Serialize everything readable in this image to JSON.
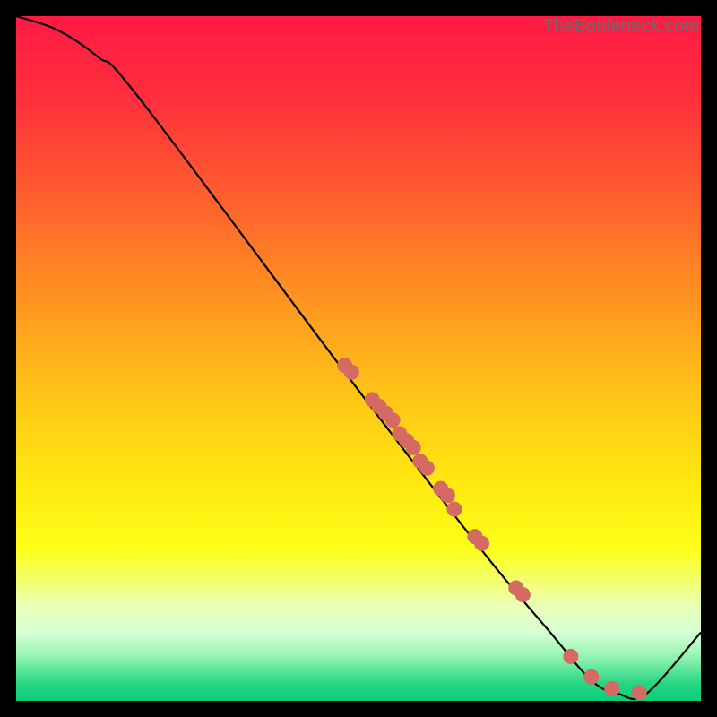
{
  "watermark": "TheBottleneck.com",
  "chart_data": {
    "type": "line",
    "title": "",
    "xlabel": "",
    "ylabel": "",
    "xlim": [
      0,
      100
    ],
    "ylim": [
      0,
      100
    ],
    "grid": false,
    "curve": [
      {
        "x": 0,
        "y": 100
      },
      {
        "x": 6,
        "y": 98
      },
      {
        "x": 12,
        "y": 94
      },
      {
        "x": 18,
        "y": 88
      },
      {
        "x": 48,
        "y": 48
      },
      {
        "x": 68,
        "y": 22
      },
      {
        "x": 78,
        "y": 10
      },
      {
        "x": 84,
        "y": 3
      },
      {
        "x": 88,
        "y": 1
      },
      {
        "x": 92,
        "y": 1
      },
      {
        "x": 100,
        "y": 10
      }
    ],
    "scatter": [
      {
        "x": 48,
        "y": 49
      },
      {
        "x": 49,
        "y": 48
      },
      {
        "x": 52,
        "y": 44
      },
      {
        "x": 53,
        "y": 43
      },
      {
        "x": 54,
        "y": 42
      },
      {
        "x": 55,
        "y": 41
      },
      {
        "x": 56,
        "y": 39
      },
      {
        "x": 57,
        "y": 38
      },
      {
        "x": 58,
        "y": 37
      },
      {
        "x": 59,
        "y": 35
      },
      {
        "x": 60,
        "y": 34
      },
      {
        "x": 62,
        "y": 31
      },
      {
        "x": 63,
        "y": 30
      },
      {
        "x": 64,
        "y": 28
      },
      {
        "x": 67,
        "y": 24
      },
      {
        "x": 68,
        "y": 23
      },
      {
        "x": 73,
        "y": 16.5
      },
      {
        "x": 74,
        "y": 15.5
      },
      {
        "x": 81,
        "y": 6.5
      },
      {
        "x": 84,
        "y": 3.5
      },
      {
        "x": 87,
        "y": 1.8
      },
      {
        "x": 91,
        "y": 1.2
      }
    ],
    "gradient_stops": [
      {
        "offset": 0.0,
        "color": "#ff1a44"
      },
      {
        "offset": 0.12,
        "color": "#ff2f3c"
      },
      {
        "offset": 0.25,
        "color": "#ff5a30"
      },
      {
        "offset": 0.4,
        "color": "#ff8f22"
      },
      {
        "offset": 0.55,
        "color": "#ffc418"
      },
      {
        "offset": 0.68,
        "color": "#ffe80f"
      },
      {
        "offset": 0.78,
        "color": "#fdff1a"
      },
      {
        "offset": 0.86,
        "color": "#eaffb4"
      },
      {
        "offset": 0.9,
        "color": "#d6ffd6"
      },
      {
        "offset": 0.93,
        "color": "#9ff7b8"
      },
      {
        "offset": 0.955,
        "color": "#5de69a"
      },
      {
        "offset": 0.975,
        "color": "#27d583"
      },
      {
        "offset": 1.0,
        "color": "#0ccd77"
      }
    ],
    "dot_color": "#d46a63",
    "line_color": "#000000"
  }
}
